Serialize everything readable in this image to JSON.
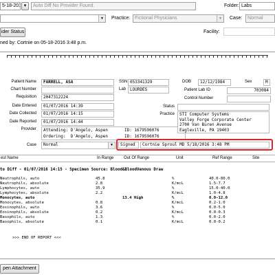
{
  "header": {
    "date_value": "5-18-2016",
    "note_value": "Auto Diff No Provider Found.",
    "folder_label": "Folder:",
    "folder_value": "Labs",
    "practice_label": "Practice:",
    "practice_value": "Fictional Physicians",
    "case_label": "Case:",
    "case_value": "Normal",
    "facility_label": "Facility:",
    "provider_status_button": "ider Status",
    "signed_text": "ned by: Cortnie on 05-18-2016  3:48 p.m."
  },
  "report": {
    "patient_name_label": "Patient Name",
    "patient_name": "FARRELL, ASA",
    "chart_number_label": "Chart Number",
    "chart_number": "",
    "requisition_label": "Requisition",
    "requisition": "2047312224",
    "date_entered_label": "Date Entered",
    "date_entered": "01/07/2016 14:39",
    "date_collected_label": "Date Collected",
    "date_collected": "01/07/2016 14:15",
    "date_reported_label": "Date Reported",
    "date_reported": "01/07/2016 14:44",
    "provider_label": "Provider",
    "attending_label": "Attending:",
    "attending": "D'Angelo, Aspen",
    "attending_id": "ID: 1679596076",
    "ordering_label": "Ordering:",
    "ordering": "D'Angelo, Aspen",
    "ordering_id": "ID: 1679596076",
    "case_label": "Case",
    "case_value": "Normal",
    "signed_label": "Signed",
    "signed_value": "Cortnie Sproul MD 5/18/2016 3:48 PM",
    "ssn_label": "SSN",
    "ssn": "053341329",
    "lab_label": "Lab",
    "lab": "LOURDES",
    "dob_label": "DOB",
    "dob": "12/12/1984",
    "sex_label": "Sex",
    "sex": "M",
    "patient_lab_id_label": "Patient Lab ID",
    "patient_lab_id": "703084",
    "control_number_label": "Control Number",
    "control_number": "",
    "status_label": "Status",
    "practice_label": "Practice",
    "practice_lines": [
      "STI Computer Systems",
      "Valley Forge Corporate Center",
      "2700 Van Buren Avenue",
      "Eagleville, PA 19403"
    ]
  },
  "results": {
    "columns": [
      "est Name",
      "In Range",
      "Out Of Range",
      "Unit",
      "Ref Range",
      "Site"
    ],
    "section_title": "to Diff - 01/07/2016 14:15 - Specimen Source: Blood&BloodVenous Draw",
    "rows": [
      {
        "name": "Neutrophils, auto",
        "in": "45.8",
        "out": "",
        "unit": "%",
        "ref": "40.0-80.0",
        "bold": false
      },
      {
        "name": "Neutrophils, absolute",
        "in": "2.8",
        "out": "",
        "unit": "K/mcL",
        "ref": "1.5-7.7",
        "bold": false
      },
      {
        "name": "Lymphocytes, auto",
        "in": "35.9",
        "out": "",
        "unit": "%",
        "ref": "15.0-40.0",
        "bold": false
      },
      {
        "name": "Lymphocytes, absolute",
        "in": "2.2",
        "out": "",
        "unit": "K/mcL",
        "ref": "1.0-4.8",
        "bold": false
      },
      {
        "name": "Monocytes, auto",
        "in": "",
        "out": "13.4 High",
        "unit": "%",
        "ref": "0.0-12.0",
        "bold": true
      },
      {
        "name": "Monocytes, absolute",
        "in": "0.8",
        "out": "",
        "unit": "K/mcL",
        "ref": "0.2-1.0",
        "bold": false
      },
      {
        "name": "Eosinophils, auto",
        "in": "3.6",
        "out": "",
        "unit": "%",
        "ref": "0.0-5.0",
        "bold": false
      },
      {
        "name": "Eosinophils, absolute",
        "in": "0.2",
        "out": "",
        "unit": "K/mcL",
        "ref": "0.0-0.3",
        "bold": false
      },
      {
        "name": "Basophils, auto",
        "in": "1.3",
        "out": "",
        "unit": "%",
        "ref": "0.0-2.0",
        "bold": false
      },
      {
        "name": "Basophils, absolute",
        "in": "0.1",
        "out": "",
        "unit": "K/mcL",
        "ref": "0.0-0.2",
        "bold": false
      }
    ],
    "end_text": ">>> END OF REPORT <<<"
  },
  "footer": {
    "open_attachment_button": "pen Attachment"
  },
  "colors": {
    "highlight": "#e0242a"
  }
}
